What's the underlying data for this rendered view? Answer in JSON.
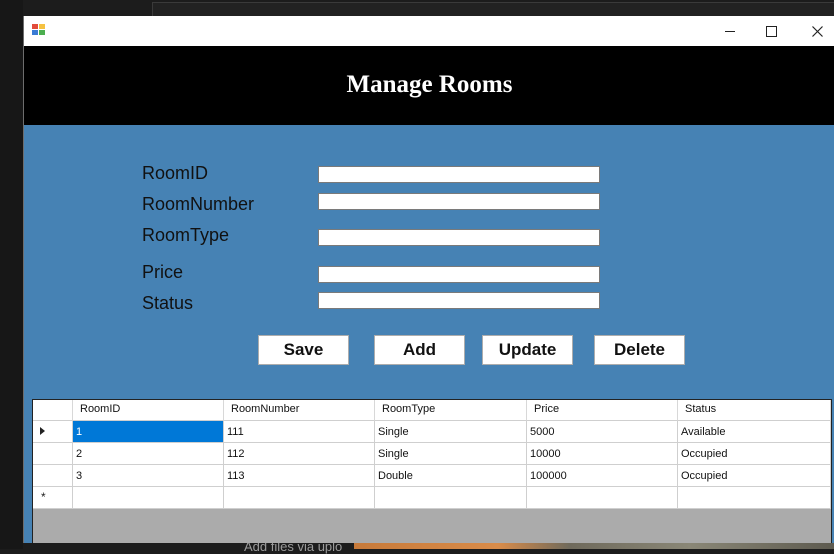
{
  "window": {
    "controls": {
      "minimize": "—",
      "maximize": "☐",
      "close": "✕"
    }
  },
  "header": {
    "title": "Manage Rooms"
  },
  "form": {
    "fields": [
      {
        "label": "RoomID",
        "value": ""
      },
      {
        "label": "RoomNumber",
        "value": ""
      },
      {
        "label": "RoomType",
        "value": ""
      },
      {
        "label": "Price",
        "value": ""
      },
      {
        "label": "Status",
        "value": ""
      }
    ],
    "buttons": {
      "save": "Save",
      "add": "Add",
      "update": "Update",
      "delete": "Delete"
    }
  },
  "grid": {
    "columns": [
      "RoomID",
      "RoomNumber",
      "RoomType",
      "Price",
      "Status"
    ],
    "rows": [
      [
        "1",
        "111",
        "Single",
        "5000",
        "Available"
      ],
      [
        "2",
        "112",
        "Single",
        "10000",
        "Occupied"
      ],
      [
        "3",
        "113",
        "Double",
        "100000",
        "Occupied"
      ]
    ],
    "new_row_marker": "*"
  },
  "background": {
    "bottom_text": "Add files via uplo"
  },
  "colors": {
    "form_background": "#4682b4",
    "header_background": "#000000",
    "selection": "#0078d7"
  }
}
